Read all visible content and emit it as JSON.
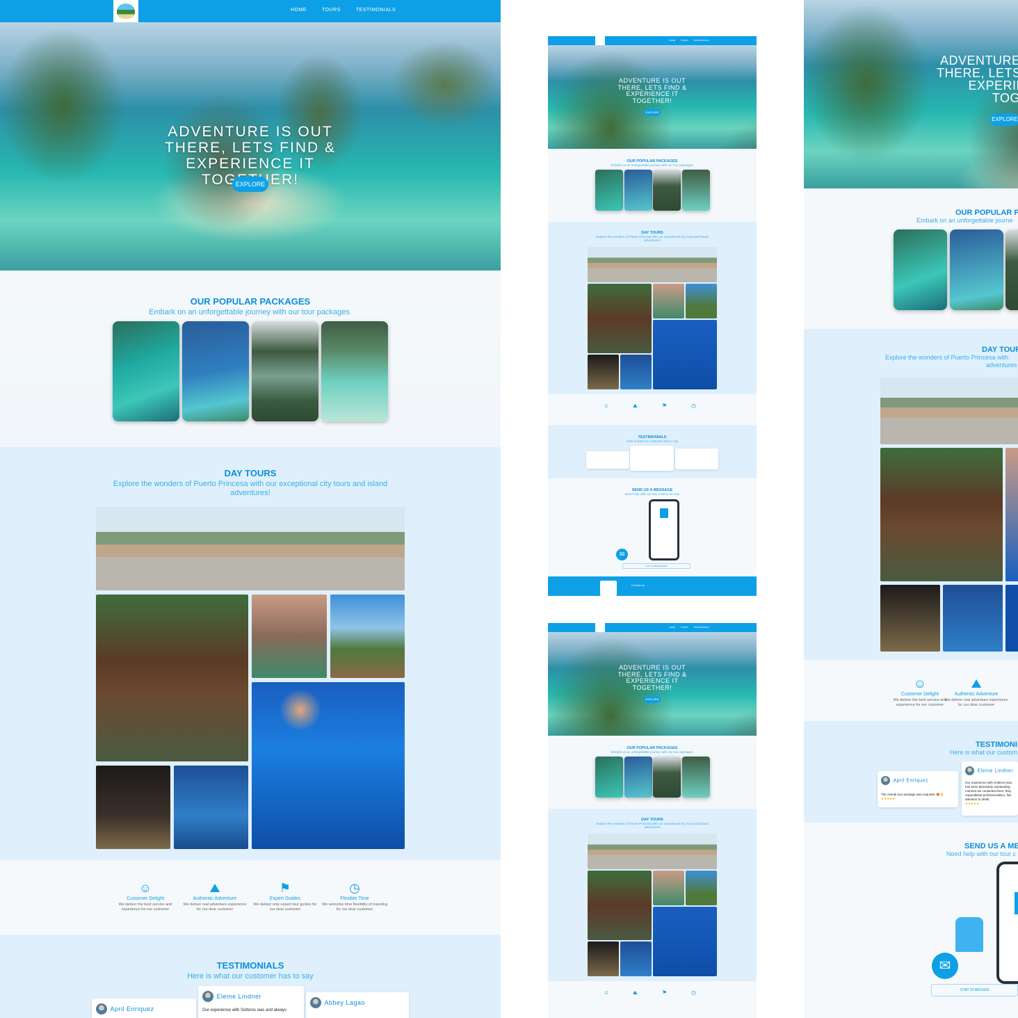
{
  "nav": {
    "items": [
      "HOME",
      "TOURS",
      "TESTIMONIALS"
    ]
  },
  "hero": {
    "title": "ADVENTURE IS OUT THERE, LETS FIND & EXPERIENCE IT TOGETHER!",
    "button": "EXPLORE"
  },
  "packages": {
    "title": "OUR POPULAR PACKAGES",
    "subtitle": "Embark on an unforgettable journey with our tour packages."
  },
  "daytours": {
    "title": "DAY TOURS",
    "subtitle": "Explore the wonders of Puerto Princesa with our exceptional city tours and island adventures!"
  },
  "features": [
    {
      "icon": "smile-icon",
      "title": "Customer Delight",
      "text": "We deliver the best service and experience for our customer"
    },
    {
      "icon": "mountain-icon",
      "title": "Authentic Adventure",
      "text": "We deliver real adventure experience for our dear customer"
    },
    {
      "icon": "flag-icon",
      "title": "Expert Guides",
      "text": "We deliver only expert tour guides for our dear customer"
    },
    {
      "icon": "timer-icon",
      "title": "Flexible Time",
      "text": "We welcome time flexibility of traveling for our dear customer"
    }
  ],
  "testimonials": {
    "title": "TESTIMONIALS",
    "subtitle": "Here is what our customer has to say",
    "items": [
      {
        "name": "April Enriquez",
        "text": "The overall tour package was exquisite 😍👌",
        "stars": "★★★★★"
      },
      {
        "name": "Eleine Lindner",
        "text": "Our experience with Solteros was and always",
        "stars": "★★★★★"
      },
      {
        "name": "Abbey Lagao",
        "text": "",
        "stars": "★★★★★"
      }
    ]
  },
  "right": {
    "hero_title": "ADVENTURE IS OUT THERE, LETS FIND & EXPERIENCE IT TOGETHER!",
    "packages_title": "OUR POPULAR PA",
    "packages_sub": "Embark on an unforgettable journe",
    "daytours_title": "DAY TOUR",
    "daytours_sub_1": "Explore the wonders of Puerto Princesa with",
    "daytours_sub_2": "adventures",
    "testimonials_title": "TESTIMONI",
    "testimonials_sub": "Here is what our custom",
    "t1_text": "The overall tour package was exquisite 😍👌",
    "t2_text": "Our experience with Solteros was has been absolutely outstanding moment we contacted them, they unparalleled professionalism, flex attention to detail.",
    "message_title": "SEND US A ME",
    "message_sub": "Need help with our tour c",
    "chat_button": "CHAT IN MESSEN"
  },
  "mid": {
    "send_title": "SEND US A MESSAGE",
    "send_sub": "Need help with our tour contact us now",
    "chat_button": "CHAT IN MESSENGER",
    "contact": "Contact us"
  },
  "colors": {
    "brand": "#0ea0e6",
    "heading": "#0c8ed8",
    "section_light": "#dff0fc"
  }
}
